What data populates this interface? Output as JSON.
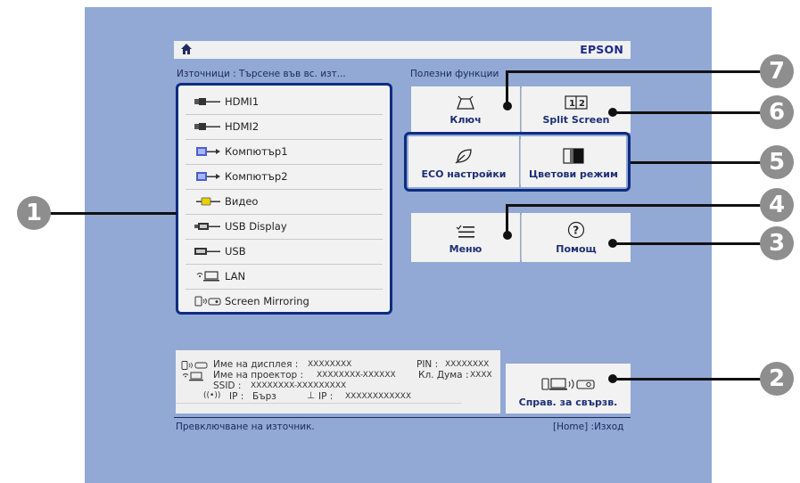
{
  "topbar": {
    "brand": "EPSON"
  },
  "sources": {
    "heading": "Източници : Търсене във вс. изт...",
    "items": [
      {
        "label": "HDMI1",
        "icon": "hdmi-icon"
      },
      {
        "label": "HDMI2",
        "icon": "hdmi-icon"
      },
      {
        "label": "Компютър1",
        "icon": "computer-port-icon"
      },
      {
        "label": "Компютър2",
        "icon": "computer-port-icon"
      },
      {
        "label": "Видео",
        "icon": "video-port-icon"
      },
      {
        "label": "USB Display",
        "icon": "usb-display-icon"
      },
      {
        "label": "USB",
        "icon": "usb-icon"
      },
      {
        "label": "LAN",
        "icon": "lan-icon"
      },
      {
        "label": "Screen Mirroring",
        "icon": "screen-mirroring-icon"
      }
    ]
  },
  "functions": {
    "heading": "Полезни функции",
    "keystone": "Ключ",
    "split": "Split Screen",
    "eco": "ECO настройки",
    "color_mode": "Цветови режим",
    "menu": "Меню",
    "help": "Помощ"
  },
  "info": {
    "display_name_label": "Име на дисплея :",
    "display_name_value": "XXXXXXXX",
    "pin_label": "PIN :",
    "pin_value": "XXXXXXXX",
    "projector_name_label": "Име на проектор :",
    "projector_name_value": "XXXXXXXX-XXXXXX",
    "keyword_label": "Кл. Дума :",
    "keyword_value": "XXXX",
    "ssid_label": "SSID :",
    "ssid_value": "XXXXXXXX-XXXXXXXXX",
    "wifi_ip_label": "IP :",
    "wifi_ip_value": "Бърз",
    "wired_ip_label": "IP :",
    "wired_ip_value": "XXXXXXXXXXXX"
  },
  "connection_button": "Справ. за свързв.",
  "footer": {
    "left": "Превключване на източник.",
    "right": "[Home] :Изход"
  },
  "callouts": [
    "1",
    "2",
    "3",
    "4",
    "5",
    "6",
    "7"
  ],
  "colors": {
    "background": "#92a8d5",
    "panel": "#f2f2f2",
    "accent": "#0c2d80",
    "brand": "#1b2a8a",
    "callout": "#8e8e8e"
  }
}
